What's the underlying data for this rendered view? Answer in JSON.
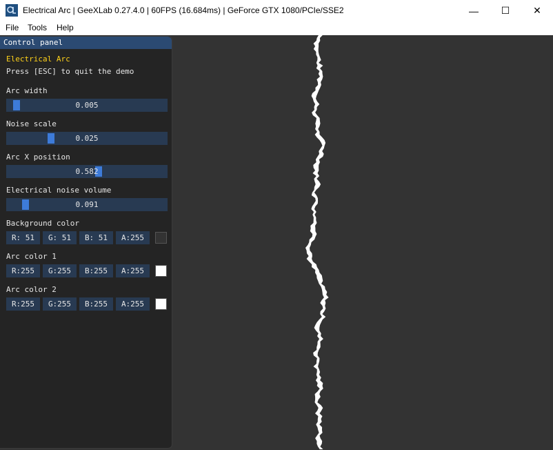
{
  "window": {
    "title": "Electrical Arc | GeeXLab 0.27.4.0 | 60FPS (16.684ms) | GeForce GTX 1080/PCIe/SSE2",
    "minimize_glyph": "—",
    "maximize_glyph": "☐",
    "close_glyph": "✕"
  },
  "menu": {
    "file": "File",
    "tools": "Tools",
    "help": "Help"
  },
  "panel": {
    "title": "Control panel",
    "demo_title": "Electrical Arc",
    "instructions": "Press [ESC] to quit the demo",
    "sliders": [
      {
        "label": "Arc width",
        "value_text": "0.005",
        "fraction": 0.03
      },
      {
        "label": "Noise scale",
        "value_text": "0.025",
        "fraction": 0.26
      },
      {
        "label": "Arc X position",
        "value_text": "0.582",
        "fraction": 0.58
      },
      {
        "label": "Electrical noise volume",
        "value_text": "0.091",
        "fraction": 0.09
      }
    ],
    "colors": [
      {
        "label": "Background color",
        "r": "R: 51",
        "g": "G: 51",
        "b": "B: 51",
        "a": "A:255",
        "swatch": "#333333"
      },
      {
        "label": "Arc color 1",
        "r": "R:255",
        "g": "G:255",
        "b": "B:255",
        "a": "A:255",
        "swatch": "#ffffff"
      },
      {
        "label": "Arc color 2",
        "r": "R:255",
        "g": "G:255",
        "b": "B:255",
        "a": "A:255",
        "swatch": "#ffffff"
      }
    ]
  },
  "scene": {
    "background": "#333333",
    "arc_color": "#ffffff"
  }
}
